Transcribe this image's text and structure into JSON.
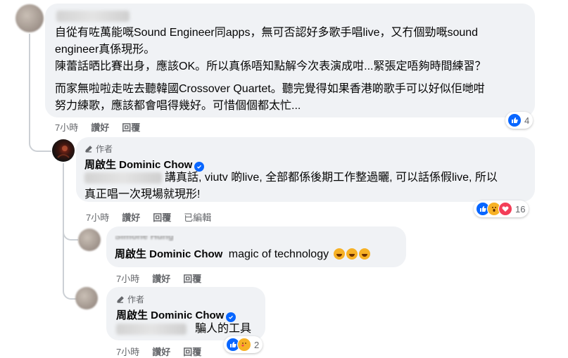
{
  "comment1": {
    "lines": [
      "自從有咗萬能嘅Sound Engineer同apps，無可否認好多歌手唱live，又冇個勁嘅sound",
      "engineer真係現形。",
      "陳蕾話晒比賽出身，應該OK。所以真係唔知點解今次表演成咁...緊張定唔夠時間練習？",
      "而家無啦啦走咗去聽韓國Crossover Quartet。聽完覺得如果香港啲歌手可以好似佢哋咁",
      "努力練歌，應該都會唱得幾好。可惜個個都太忙..."
    ],
    "time": "7小時",
    "like": "讚好",
    "reply": "回覆",
    "reaction_count": "4"
  },
  "reply1": {
    "author_label": "作者",
    "name": "周啟生 Dominic Chow",
    "line1": "講真話, viutv 啲live, 全部都係後期工作整過曬, 可以話係假live, 所以",
    "line2": "真正唱一次現場就現形!",
    "time": "7小時",
    "like": "讚好",
    "reply": "回覆",
    "edited": "已編輯",
    "reaction_count": "16"
  },
  "reply2": {
    "partial_name": "Simone Hung",
    "mention": "周啟生 Dominic Chow",
    "text": "magic of technology",
    "time": "7小時",
    "like": "讚好",
    "reply": "回覆"
  },
  "reply3": {
    "author_label": "作者",
    "name": "周啟生 Dominic Chow",
    "text": "騙人的工具",
    "time": "7小時",
    "like": "讚好",
    "reply": "回覆",
    "reaction_count": "2"
  },
  "colors": {
    "like_blue": "#0866ff",
    "bubble": "#f0f2f5",
    "muted": "#65676b",
    "love": "#f33e58",
    "haha": "#f7b125"
  },
  "icons": [
    "like-icon",
    "wow-icon",
    "love-icon",
    "care-icon",
    "verified-icon",
    "pencil-icon",
    "haha-emoji"
  ]
}
